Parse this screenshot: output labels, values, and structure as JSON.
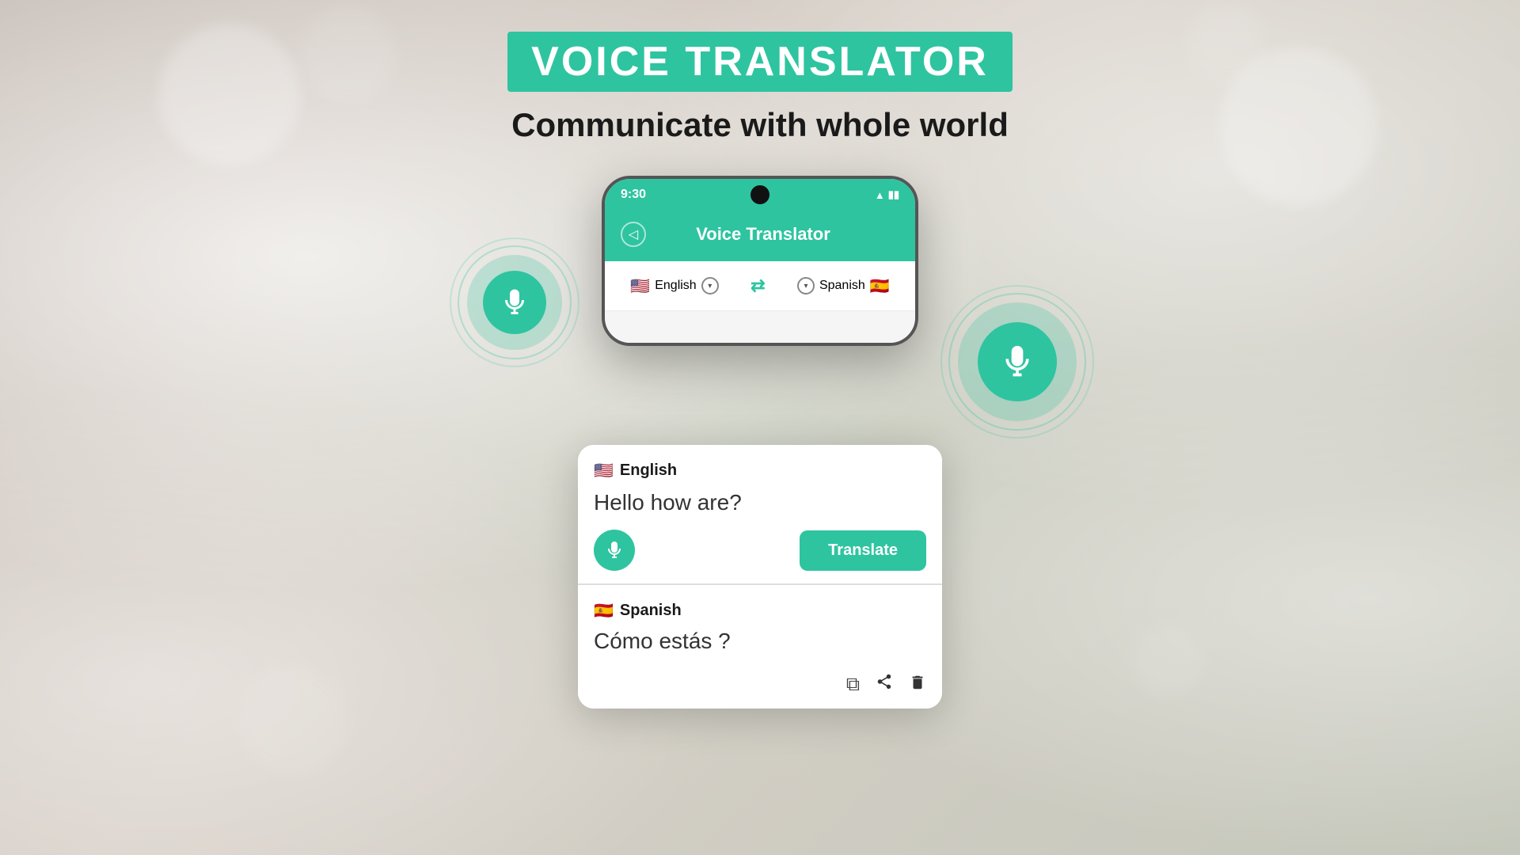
{
  "header": {
    "title": "VOICE TRANSLATOR",
    "subtitle": "Communicate with whole world"
  },
  "phone": {
    "status_time": "9:30",
    "app_title": "Voice Translator",
    "back_icon": "◁",
    "lang_from": "English",
    "lang_to": "Spanish",
    "flag_from": "🇺🇸",
    "flag_to": "🇪🇸",
    "swap_icon": "⇄",
    "chevron_icon": "▾"
  },
  "input_section": {
    "lang_label": "English",
    "flag": "🇺🇸",
    "input_text": "Hello how are?",
    "translate_btn": "Translate"
  },
  "output_section": {
    "lang_label": "Spanish",
    "flag": "🇪🇸",
    "output_text": "Cómo estás ?"
  },
  "actions": {
    "copy": "⧉",
    "share": "⇧",
    "delete": "🗑"
  },
  "mic_left": {
    "aria": "microphone-left"
  },
  "mic_right": {
    "aria": "microphone-right"
  }
}
